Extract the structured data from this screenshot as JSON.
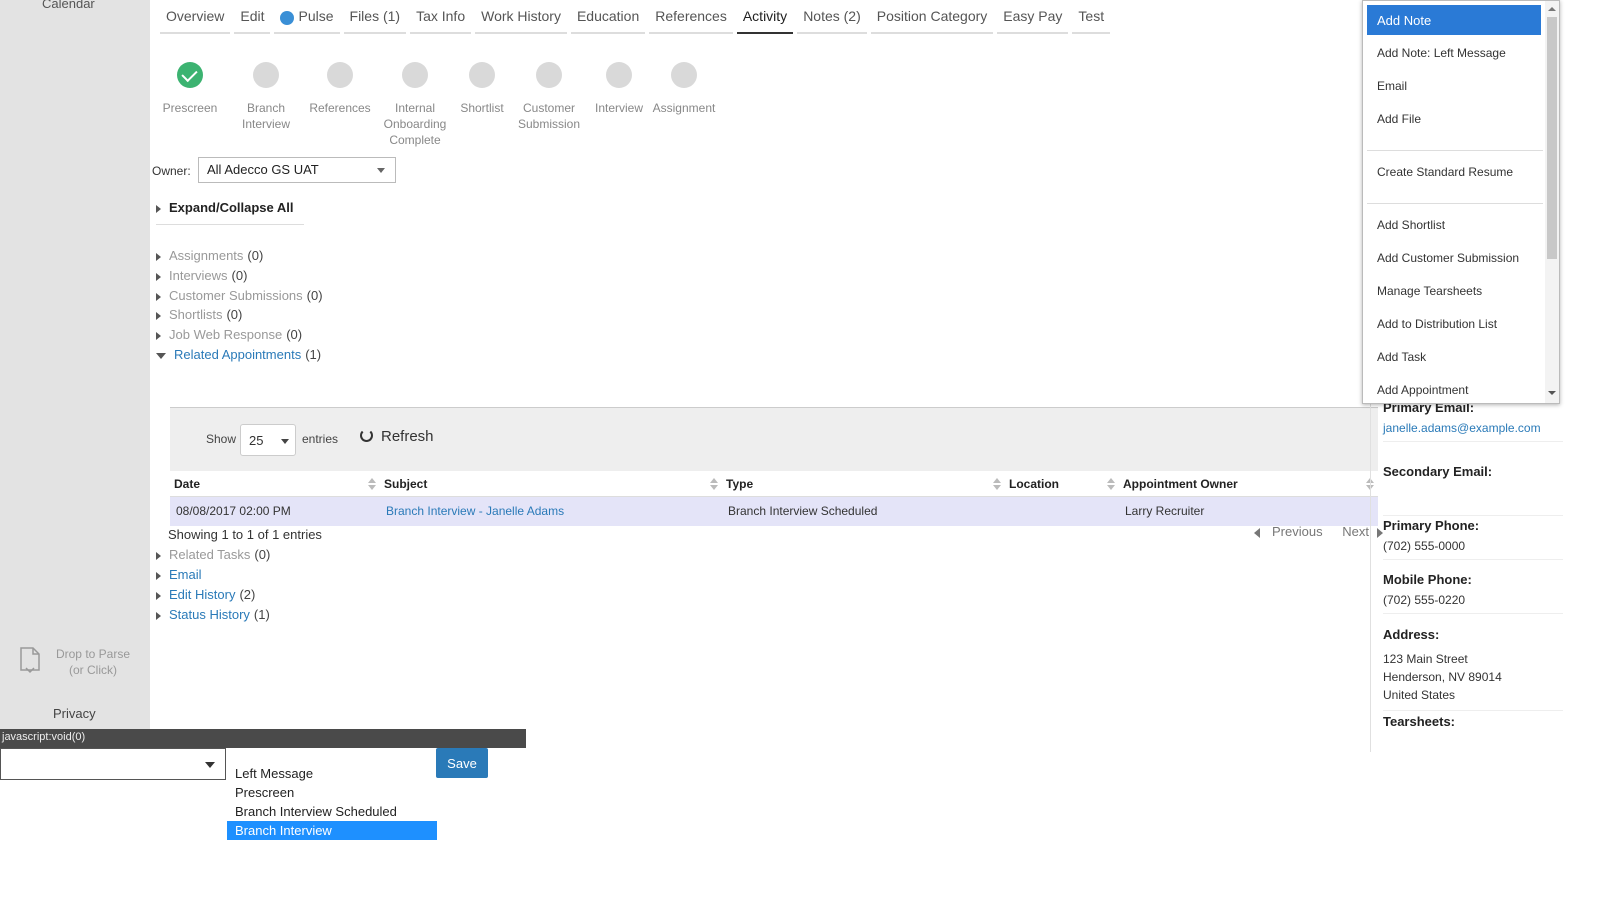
{
  "sidebar": {
    "calendar_label": "Calendar",
    "drop_line1": "Drop to Parse",
    "drop_line2": "(or Click)",
    "privacy_label": "Privacy"
  },
  "tabs": [
    {
      "label": "Overview"
    },
    {
      "label": "Edit"
    },
    {
      "label": "Pulse"
    },
    {
      "label": "Files (1)"
    },
    {
      "label": "Tax Info"
    },
    {
      "label": "Work History"
    },
    {
      "label": "Education"
    },
    {
      "label": "References"
    },
    {
      "label": "Activity"
    },
    {
      "label": "Notes (2)"
    },
    {
      "label": "Position Category"
    },
    {
      "label": "Easy Pay"
    },
    {
      "label": "Test"
    }
  ],
  "active_tab": "Activity",
  "pipeline": [
    {
      "label_lines": [
        "Prescreen"
      ],
      "done": true
    },
    {
      "label_lines": [
        "Branch",
        "Interview"
      ],
      "done": false
    },
    {
      "label_lines": [
        "References"
      ],
      "done": false
    },
    {
      "label_lines": [
        "Internal",
        "Onboarding",
        "Complete"
      ],
      "done": false
    },
    {
      "label_lines": [
        "Shortlist"
      ],
      "done": false
    },
    {
      "label_lines": [
        "Customer",
        "Submission"
      ],
      "done": false
    },
    {
      "label_lines": [
        "Interview"
      ],
      "done": false
    },
    {
      "label_lines": [
        "Assignment"
      ],
      "done": false
    }
  ],
  "owner": {
    "label": "Owner:",
    "value": "All Adecco GS UAT"
  },
  "expand_all_label": "Expand/Collapse All",
  "sections": [
    {
      "label": "Assignments",
      "count": "(0)",
      "link": false,
      "expanded": false
    },
    {
      "label": "Interviews",
      "count": "(0)",
      "link": false,
      "expanded": false
    },
    {
      "label": "Customer Submissions",
      "count": "(0)",
      "link": false,
      "expanded": false
    },
    {
      "label": "Shortlists",
      "count": "(0)",
      "link": false,
      "expanded": false
    },
    {
      "label": "Job Web Response",
      "count": "(0)",
      "link": false,
      "expanded": false
    },
    {
      "label": "Related Appointments",
      "count": "(1)",
      "link": true,
      "expanded": true
    }
  ],
  "sections_after": [
    {
      "label": "Related Tasks",
      "count": "(0)",
      "link": false
    },
    {
      "label": "Email",
      "count": "",
      "link": true
    },
    {
      "label": "Edit History",
      "count": "(2)",
      "link": true
    },
    {
      "label": "Status History",
      "count": "(1)",
      "link": true
    }
  ],
  "appointments": {
    "show_label": "Show",
    "entries_value": "25",
    "entries_label": "entries",
    "refresh_label": "Refresh",
    "columns": [
      "Date",
      "Subject",
      "Type",
      "Location",
      "Appointment Owner"
    ],
    "rows": [
      {
        "date": "08/08/2017 02:00 PM",
        "subject": "Branch Interview - Janelle Adams",
        "type": "Branch Interview Scheduled",
        "location": "",
        "owner": "Larry Recruiter"
      }
    ],
    "showing_text": "Showing 1 to 1 of 1 entries",
    "previous_label": "Previous",
    "next_label": "Next"
  },
  "contact": {
    "primary_email_label": "Primary Email:",
    "primary_email": "janelle.adams@example.com",
    "secondary_email_label": "Secondary Email:",
    "primary_phone_label": "Primary Phone:",
    "primary_phone": "(702) 555-0000",
    "mobile_phone_label": "Mobile Phone:",
    "mobile_phone": "(702) 555-0220",
    "address_label": "Address:",
    "address_lines": [
      "123 Main Street",
      "Henderson, NV 89014",
      "United States"
    ],
    "tearsheets_label": "Tearsheets:"
  },
  "actions_menu": {
    "items": [
      "Add Note",
      "Add Note: Left Message",
      "Email",
      "Add File",
      "Create Standard Resume",
      "Add Shortlist",
      "Add Customer Submission",
      "Manage Tearsheets",
      "Add to Distribution List",
      "Add Task",
      "Add Appointment"
    ],
    "selected": "Add Note"
  },
  "statusbar_text": "javascript:void(0)",
  "note_form": {
    "select_value": "",
    "save_label": "Save",
    "options": [
      "Left Message",
      "Prescreen",
      "Branch Interview Scheduled",
      "Branch Interview"
    ],
    "selected_option": "Branch Interview"
  },
  "colors": {
    "accent": "#2a7ab8",
    "selected_menu": "#2a7ad6",
    "done_stage": "#3cb371",
    "row_highlight": "#e4e4f8"
  }
}
